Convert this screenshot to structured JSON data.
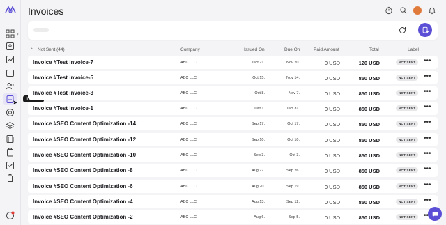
{
  "header": {
    "title": "Invoices"
  },
  "sidebar": {
    "tooltip": "Invoices"
  },
  "group": {
    "label": "Not Sent (44)"
  },
  "columns": {
    "company": "Company",
    "issued": "Issued On",
    "due": "Due On",
    "paid": "Paid Amount",
    "total": "Total",
    "label": "Label"
  },
  "rows": [
    {
      "name": "Invoice #Test invoice-7",
      "company": "ABC LLC",
      "issued": "Oct 21.",
      "due": "Nov 20.",
      "paid": "0 USD",
      "total": "120 USD",
      "label": "NOT SENT"
    },
    {
      "name": "Invoice #Test invoice-5",
      "company": "ABC LLC",
      "issued": "Oct 15.",
      "due": "Nov 14.",
      "paid": "0 USD",
      "total": "850 USD",
      "label": "NOT SENT"
    },
    {
      "name": "Invoice #Test invoice-3",
      "company": "ABC LLC",
      "issued": "Oct 8.",
      "due": "Nov 7.",
      "paid": "0 USD",
      "total": "850 USD",
      "label": "NOT SENT"
    },
    {
      "name": "Invoice #Test invoice-1",
      "company": "ABC LLC",
      "issued": "Oct 1.",
      "due": "Oct 31.",
      "paid": "0 USD",
      "total": "850 USD",
      "label": "NOT SENT"
    },
    {
      "name": "Invoice #SEO Content Optimization -14",
      "company": "ABC LLC",
      "issued": "Sep 17.",
      "due": "Oct 17.",
      "paid": "0 USD",
      "total": "850 USD",
      "label": "NOT SENT"
    },
    {
      "name": "Invoice #SEO Content Optimization -12",
      "company": "ABC LLC",
      "issued": "Sep 10.",
      "due": "Oct 10.",
      "paid": "0 USD",
      "total": "850 USD",
      "label": "NOT SENT"
    },
    {
      "name": "Invoice #SEO Content Optimization -10",
      "company": "ABC LLC",
      "issued": "Sep 3.",
      "due": "Oct 3.",
      "paid": "0 USD",
      "total": "850 USD",
      "label": "NOT SENT"
    },
    {
      "name": "Invoice #SEO Content Optimization -8",
      "company": "ABC LLC",
      "issued": "Aug 27.",
      "due": "Sep 26.",
      "paid": "0 USD",
      "total": "850 USD",
      "label": "NOT SENT"
    },
    {
      "name": "Invoice #SEO Content Optimization -6",
      "company": "ABC LLC",
      "issued": "Aug 20.",
      "due": "Sep 19.",
      "paid": "0 USD",
      "total": "850 USD",
      "label": "NOT SENT"
    },
    {
      "name": "Invoice #SEO Content Optimization -4",
      "company": "ABC LLC",
      "issued": "Aug 13.",
      "due": "Sep 12.",
      "paid": "0 USD",
      "total": "850 USD",
      "label": "NOT SENT"
    },
    {
      "name": "Invoice #SEO Content Optimization -2",
      "company": "ABC LLC",
      "issued": "Aug 6.",
      "due": "Sep 5.",
      "paid": "0 USD",
      "total": "850 USD",
      "label": "NOT SENT"
    }
  ],
  "colors": {
    "accent": "#5b4fd6",
    "badge_bg": "#e7e7e9"
  }
}
